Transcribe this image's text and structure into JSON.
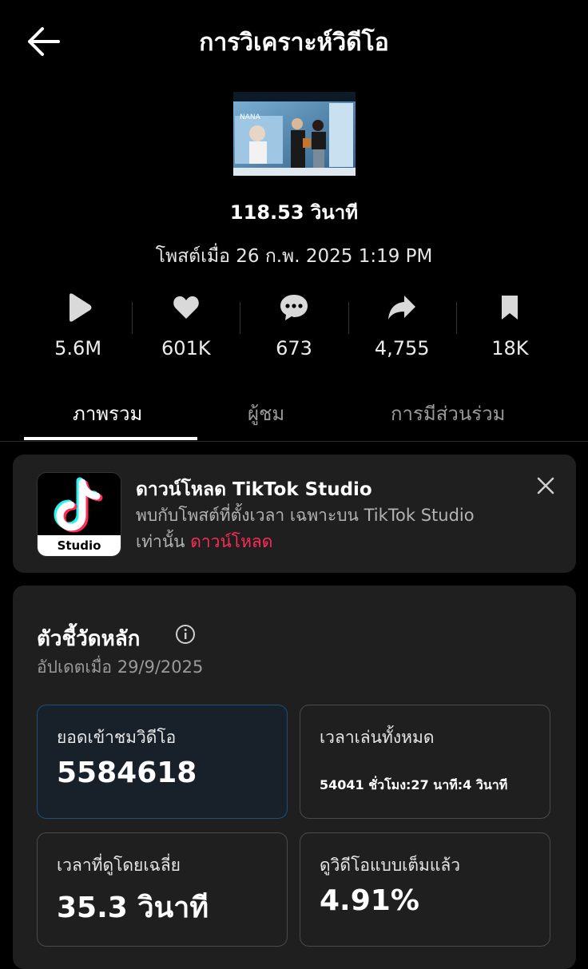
{
  "header": {
    "title": "การวิเคราะห์วิดีโอ",
    "back_icon": "arrow-left-icon"
  },
  "video": {
    "duration": "118.53 วินาที",
    "posted": "โพสต์เมื่อ 26 ก.พ. 2025 1:19 PM",
    "thumbnail_text": "NANA"
  },
  "stats": [
    {
      "icon": "play-icon",
      "value": "5.6M"
    },
    {
      "icon": "heart-icon",
      "value": "601K"
    },
    {
      "icon": "comment-icon",
      "value": "673"
    },
    {
      "icon": "share-icon",
      "value": "4,755"
    },
    {
      "icon": "bookmark-icon",
      "value": "18K"
    }
  ],
  "tabs": [
    {
      "label": "ภาพรวม",
      "active": true
    },
    {
      "label": "ผู้ชม",
      "active": false
    },
    {
      "label": "การมีส่วนร่วม",
      "active": false
    }
  ],
  "promo": {
    "title": "ดาวน์โหลด TikTok Studio",
    "description": "พบกับโพสต์ที่ตั้งเวลา เฉพาะบน TikTok Studio เท่านั้น",
    "link": "ดาวน์โหลด",
    "logo_label": "Studio"
  },
  "metrics": {
    "title": "ตัวชี้วัดหลัก",
    "updated": "อัปเดตเมื่อ 29/9/2025",
    "cards": [
      {
        "label": "ยอดเข้าชมวิดีโอ",
        "value": "5584618"
      },
      {
        "label": "เวลาเล่นทั้งหมด",
        "value": "54041 ชั่วโมง:27 นาที:4 วินาที"
      },
      {
        "label": "เวลาที่ดูโดยเฉลี่ย",
        "value": "35.3 วินาที"
      },
      {
        "label": "ดูวิดีโอแบบเต็มแล้ว",
        "value": "4.91%"
      }
    ]
  },
  "colors": {
    "background": "#000000",
    "card": "#1f1f1f",
    "accent_link": "#fe2c55",
    "selected_border": "#1e4e79"
  }
}
